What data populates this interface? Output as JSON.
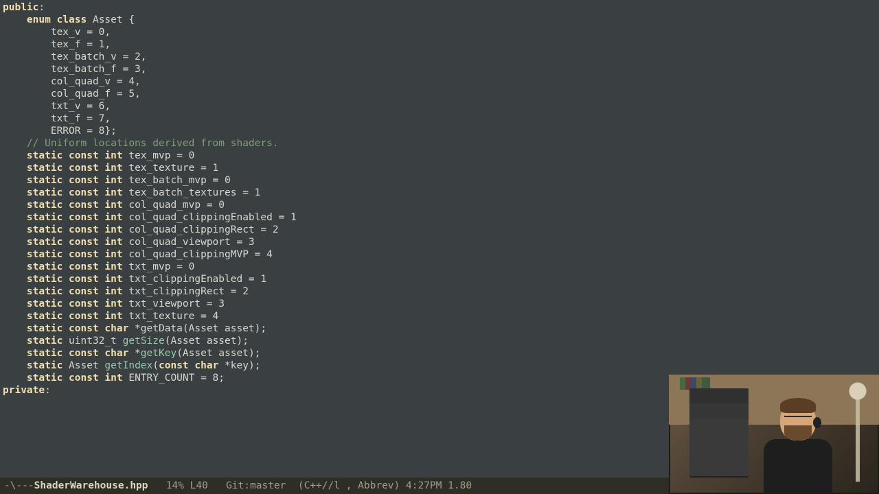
{
  "code": {
    "lines": [
      {
        "indent": 0,
        "tokens": [
          {
            "t": "public",
            "c": "kw"
          },
          {
            "t": ":",
            "c": ""
          }
        ]
      },
      {
        "indent": 0,
        "tokens": []
      },
      {
        "indent": 4,
        "tokens": [
          {
            "t": "enum class",
            "c": "kw"
          },
          {
            "t": " Asset {",
            "c": ""
          }
        ]
      },
      {
        "indent": 8,
        "tokens": [
          {
            "t": "tex_v = 0,",
            "c": ""
          }
        ]
      },
      {
        "indent": 8,
        "tokens": [
          {
            "t": "tex_f = 1,",
            "c": ""
          }
        ]
      },
      {
        "indent": 8,
        "tokens": [
          {
            "t": "tex_batch_v = 2,",
            "c": ""
          }
        ]
      },
      {
        "indent": 8,
        "tokens": [
          {
            "t": "tex_batch_f = 3,",
            "c": ""
          }
        ]
      },
      {
        "indent": 8,
        "tokens": [
          {
            "t": "col_quad_v = 4,",
            "c": ""
          }
        ]
      },
      {
        "indent": 8,
        "tokens": [
          {
            "t": "col_quad_f = 5,",
            "c": ""
          }
        ]
      },
      {
        "indent": 8,
        "tokens": [
          {
            "t": "txt_v = 6,",
            "c": ""
          }
        ]
      },
      {
        "indent": 8,
        "tokens": [
          {
            "t": "txt_f = 7,",
            "c": ""
          }
        ]
      },
      {
        "indent": 8,
        "tokens": [
          {
            "t": "ERROR = 8};",
            "c": ""
          }
        ]
      },
      {
        "indent": 0,
        "tokens": []
      },
      {
        "indent": 4,
        "tokens": [
          {
            "t": "// Uniform locations derived from shaders.",
            "c": "cm"
          }
        ]
      },
      {
        "indent": 4,
        "tokens": [
          {
            "t": "static const int",
            "c": "kw"
          },
          {
            "t": " tex_mvp = 0",
            "c": ""
          }
        ]
      },
      {
        "indent": 4,
        "tokens": [
          {
            "t": "static const int",
            "c": "kw"
          },
          {
            "t": " tex_texture = 1",
            "c": ""
          }
        ]
      },
      {
        "indent": 4,
        "tokens": [
          {
            "t": "static const int",
            "c": "kw"
          },
          {
            "t": " tex_batch_mvp = 0",
            "c": ""
          }
        ]
      },
      {
        "indent": 4,
        "tokens": [
          {
            "t": "static const int",
            "c": "kw"
          },
          {
            "t": " tex_batch_textures = 1",
            "c": ""
          }
        ]
      },
      {
        "indent": 4,
        "tokens": [
          {
            "t": "static const int",
            "c": "kw"
          },
          {
            "t": " col_quad_mvp = 0",
            "c": ""
          }
        ]
      },
      {
        "indent": 4,
        "tokens": [
          {
            "t": "static const int",
            "c": "kw"
          },
          {
            "t": " col_quad_clippingEnabled = 1",
            "c": ""
          }
        ]
      },
      {
        "indent": 4,
        "tokens": [
          {
            "t": "static const int",
            "c": "kw"
          },
          {
            "t": " col_quad_clippingRect = 2",
            "c": ""
          }
        ]
      },
      {
        "indent": 4,
        "tokens": [
          {
            "t": "static const int",
            "c": "kw"
          },
          {
            "t": " col_quad_viewport = 3",
            "c": ""
          }
        ]
      },
      {
        "indent": 4,
        "tokens": [
          {
            "t": "static const int",
            "c": "kw"
          },
          {
            "t": " col_quad_clippingMVP = 4",
            "c": ""
          }
        ]
      },
      {
        "indent": 4,
        "tokens": [
          {
            "t": "static const int",
            "c": "kw"
          },
          {
            "t": " txt_mvp = 0",
            "c": ""
          }
        ]
      },
      {
        "indent": 4,
        "tokens": [
          {
            "t": "static const int",
            "c": "kw"
          },
          {
            "t": " txt_clippingEnabled = 1",
            "c": ""
          }
        ]
      },
      {
        "indent": 4,
        "tokens": [
          {
            "t": "static const int",
            "c": "kw"
          },
          {
            "t": " txt_clippingRect = 2",
            "c": ""
          }
        ]
      },
      {
        "indent": 4,
        "tokens": [
          {
            "t": "static const int",
            "c": "kw"
          },
          {
            "t": " txt_viewport = 3",
            "c": ""
          }
        ]
      },
      {
        "indent": 4,
        "tokens": [
          {
            "t": "static const int",
            "c": "kw"
          },
          {
            "t": " txt_texture = 4",
            "c": ""
          }
        ]
      },
      {
        "indent": 0,
        "tokens": []
      },
      {
        "indent": 4,
        "tokens": [
          {
            "t": "static const char",
            "c": "kw"
          },
          {
            "t": " *getData(Asset asset);",
            "c": ""
          }
        ]
      },
      {
        "indent": 4,
        "tokens": [
          {
            "t": "static",
            "c": "kw"
          },
          {
            "t": " uint32_t ",
            "c": ""
          },
          {
            "t": "getSize",
            "c": "fn"
          },
          {
            "t": "(Asset asset);",
            "c": ""
          }
        ]
      },
      {
        "indent": 0,
        "tokens": []
      },
      {
        "indent": 4,
        "tokens": [
          {
            "t": "static const char",
            "c": "kw"
          },
          {
            "t": " *",
            "c": ""
          },
          {
            "t": "getKey",
            "c": "fn"
          },
          {
            "t": "(Asset asset);",
            "c": ""
          }
        ]
      },
      {
        "indent": 4,
        "tokens": [
          {
            "t": "static",
            "c": "kw"
          },
          {
            "t": " Asset ",
            "c": ""
          },
          {
            "t": "getIndex",
            "c": "fn"
          },
          {
            "t": "(",
            "c": ""
          },
          {
            "t": "const char",
            "c": "kw"
          },
          {
            "t": " *key);",
            "c": ""
          }
        ]
      },
      {
        "indent": 0,
        "tokens": []
      },
      {
        "indent": 4,
        "tokens": [
          {
            "t": "static const int",
            "c": "kw"
          },
          {
            "t": " ENTRY_COUNT = 8;",
            "c": ""
          }
        ]
      },
      {
        "indent": 0,
        "tokens": []
      },
      {
        "indent": 0,
        "tokens": [
          {
            "t": "private",
            "c": "kw"
          },
          {
            "t": ":",
            "c": ""
          }
        ]
      }
    ]
  },
  "modeline": {
    "prefix": "-\\---",
    "filename": "ShaderWarehouse.hpp",
    "percent": "14%",
    "line": "L40",
    "vcs": "Git:master",
    "mode": "(C++//l , Abbrev)",
    "time": "4:27PM",
    "load": "1.80"
  }
}
